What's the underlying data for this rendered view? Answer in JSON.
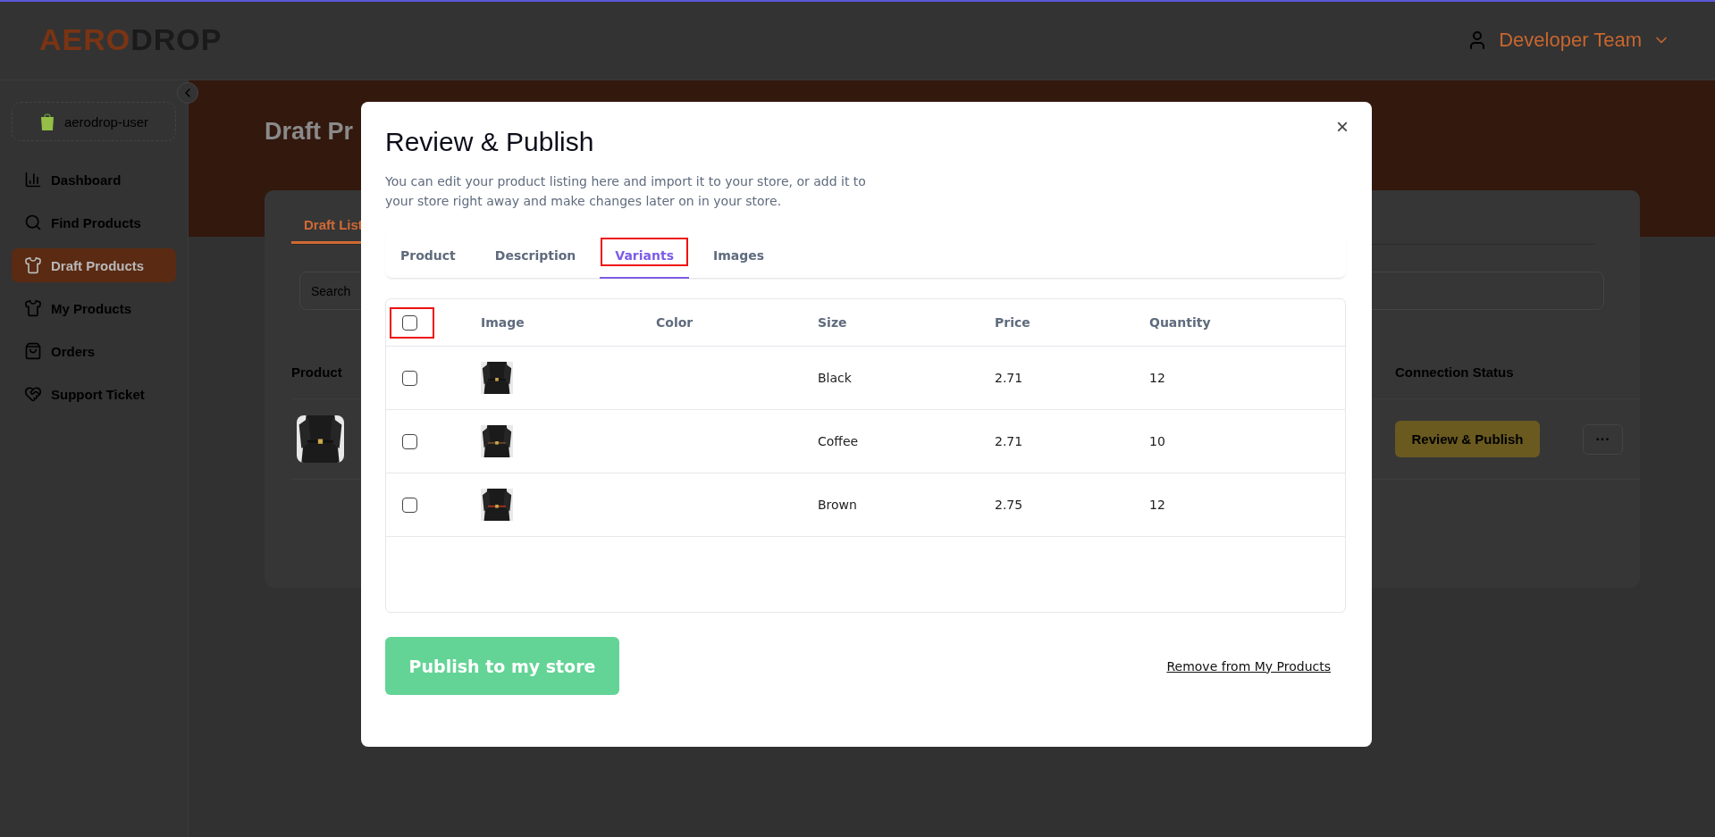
{
  "header": {
    "logo": [
      {
        "text": "AER",
        "color": "#7a3414"
      },
      {
        "text": "O",
        "color": "#7a3414"
      },
      {
        "text": "DROP",
        "color": "#1a1a1a"
      }
    ],
    "user": "Developer Team"
  },
  "sidebar": {
    "store": "aerodrop-user",
    "items": [
      {
        "label": "Dashboard",
        "selected": false
      },
      {
        "label": "Find Products",
        "selected": false
      },
      {
        "label": "Draft Products",
        "selected": true
      },
      {
        "label": "My Products",
        "selected": false
      },
      {
        "label": "Orders",
        "selected": false
      },
      {
        "label": "Support Ticket",
        "selected": false
      }
    ]
  },
  "page": {
    "title": "Draft Pr",
    "tabs": [
      {
        "label": "Draft List",
        "selected": true
      }
    ],
    "search": {
      "placeholder": "Search"
    },
    "columns": [
      "Product",
      "Connection Status"
    ],
    "rows": [
      {
        "action": "Review & Publish",
        "more": "···"
      }
    ]
  },
  "modal": {
    "title": "Review & Publish",
    "description": "You can edit your product listing here and import it to your store, or add it to your store right away and make changes later on in your store.",
    "close": "×",
    "tabs": [
      {
        "label": "Product",
        "selected": false,
        "highlighted": false
      },
      {
        "label": "Description",
        "selected": false,
        "highlighted": false
      },
      {
        "label": "Variants",
        "selected": true,
        "highlighted": true
      },
      {
        "label": "Images",
        "selected": false,
        "highlighted": false
      }
    ],
    "table": {
      "select_all": {
        "checked": false,
        "highlighted": true
      },
      "columns": [
        "Image",
        "Color",
        "Size",
        "Price",
        "Quantity"
      ],
      "rows": [
        {
          "checked": false,
          "size": "Black",
          "price": "2.71",
          "quantity": "12"
        },
        {
          "checked": false,
          "size": "Coffee",
          "price": "2.71",
          "quantity": "10"
        },
        {
          "checked": false,
          "size": "Brown",
          "price": "2.75",
          "quantity": "12"
        }
      ]
    },
    "publish": "Publish to my store",
    "remove": "Remove from My Products"
  }
}
